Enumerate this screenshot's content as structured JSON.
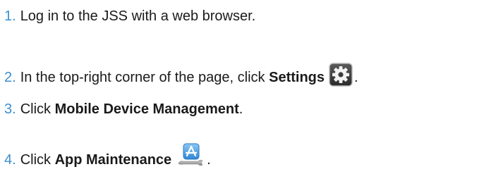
{
  "steps": [
    {
      "number": "1.",
      "text": "Log in to the JSS with a web browser."
    },
    {
      "number": "2.",
      "text_before": "In the top-right corner of the page, click ",
      "bold": "Settings",
      "icon": "gear-icon",
      "text_after": "."
    },
    {
      "number": "3.",
      "text_before": "Click ",
      "bold": "Mobile Device Management",
      "text_after": "."
    },
    {
      "number": "4.",
      "text_before": "Click ",
      "bold": "App Maintenance",
      "icon": "app-store-wrench-icon",
      "text_after": "."
    }
  ],
  "colors": {
    "number": "#3d8fd0",
    "text": "#1a1a1a",
    "gear_bg": "#3b3b3b",
    "app_icon_blue": "#3f97e0",
    "wrench_gray": "#9a9a9a"
  }
}
